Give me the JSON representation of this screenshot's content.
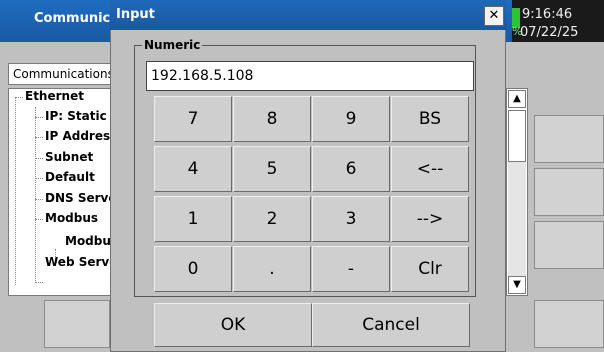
{
  "app": {
    "title": "Communications",
    "time": "9:16:46",
    "date": "07/22/25",
    "percent_glyph": "%",
    "comm_tab_label": "Communications",
    "tree": [
      {
        "label": "Ethernet"
      },
      {
        "label": "IP: Static"
      },
      {
        "label": "IP Address"
      },
      {
        "label": "Subnet"
      },
      {
        "label": "Default"
      },
      {
        "label": "DNS Server"
      },
      {
        "label": "Modbus"
      },
      {
        "label": "Modbus"
      },
      {
        "label": "Web Server"
      }
    ],
    "scroll_up_glyph": "▲",
    "scroll_down_glyph": "▼"
  },
  "dialog": {
    "title": "Input",
    "close_glyph": "✕",
    "group_label": "Numeric",
    "input_value": "192.168.5.108",
    "keys": [
      [
        "7",
        "8",
        "9",
        "BS"
      ],
      [
        "4",
        "5",
        "6",
        "<--"
      ],
      [
        "1",
        "2",
        "3",
        "-->"
      ],
      [
        "0",
        ".",
        "-",
        "Clr"
      ]
    ],
    "ok_label": "OK",
    "cancel_label": "Cancel"
  },
  "colors": {
    "title_bar": "#1a5fae",
    "status_green": "#2ec23a",
    "background": "#c0c0c0"
  }
}
